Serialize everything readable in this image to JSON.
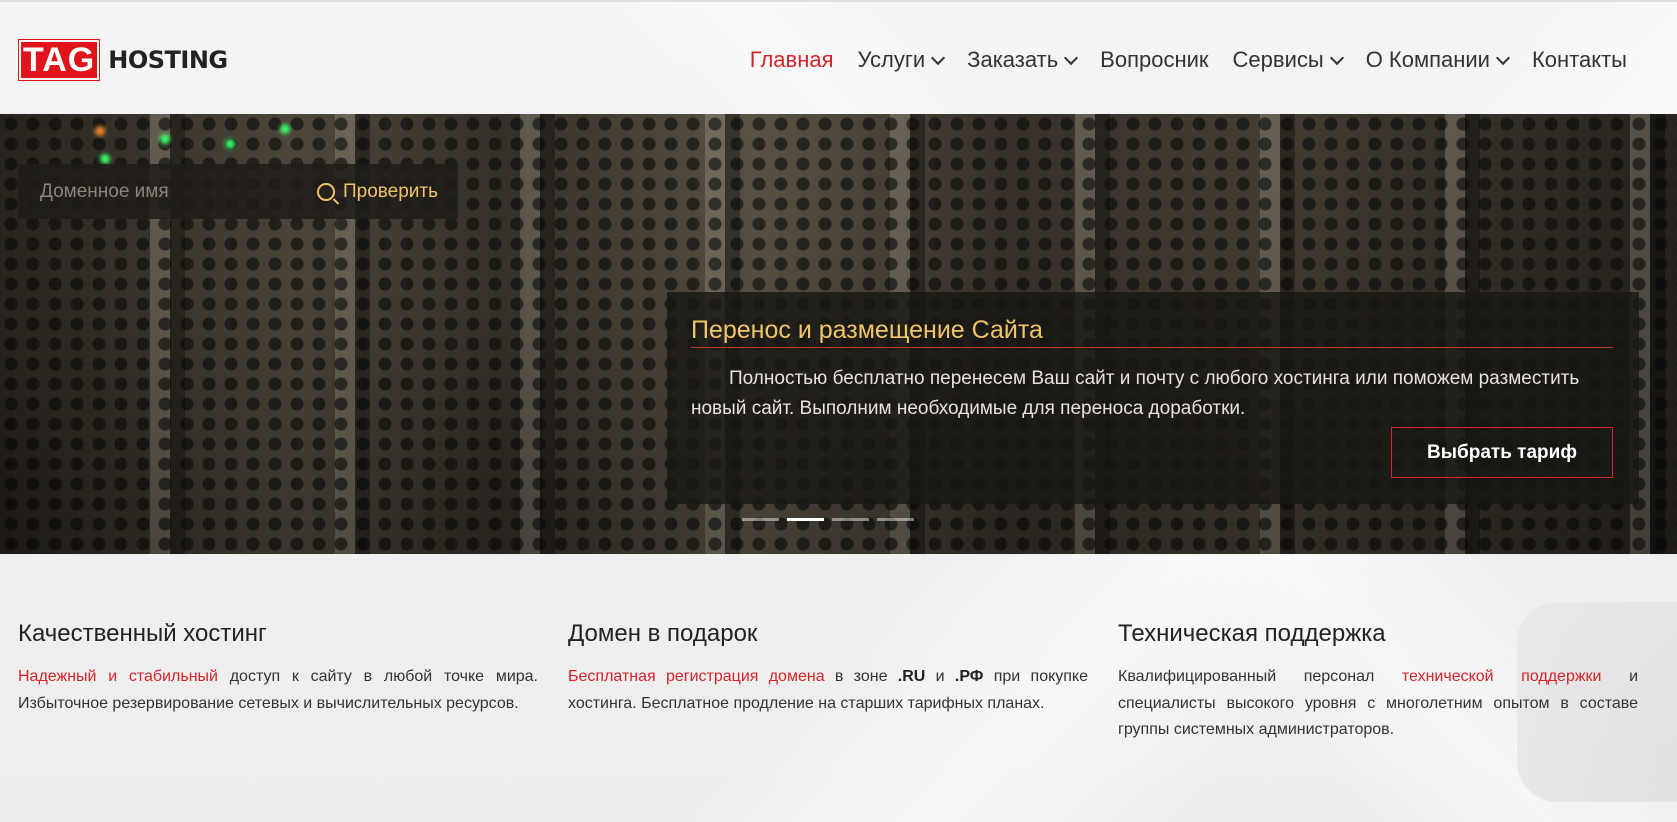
{
  "logo": {
    "tag": "TAG",
    "hosting": "HOSTING"
  },
  "nav": {
    "items": [
      {
        "label": "Главная",
        "active": true
      },
      {
        "label": "Услуги",
        "dropdown": true
      },
      {
        "label": "Заказать",
        "dropdown": true
      },
      {
        "label": "Вопросник"
      },
      {
        "label": "Сервисы",
        "dropdown": true
      },
      {
        "label": "О Компании",
        "dropdown": true
      },
      {
        "label": "Контакты"
      }
    ]
  },
  "domain_search": {
    "placeholder": "Доменное имя",
    "button_label": "Проверить",
    "icon": "search-icon"
  },
  "slide": {
    "title": "Перенос и размещение Сайта",
    "text": "Полностью бесплатно перенесем Ваш сайт и почту с любого хостинга или поможем разместить новый сайт. Выполним необходимые для переноса доработки.",
    "button_label": "Выбрать тариф",
    "dots_count": 4,
    "active_dot": 2
  },
  "features": [
    {
      "title": "Качественный хостинг",
      "highlight": "Надежный и стабильный",
      "text": " доступ к сайту в любой точке мира. Избыточное резервирование сетевых и вычислительных ресурсов."
    },
    {
      "title": "Домен в подарок",
      "highlight": "Бесплатная регистрация домена",
      "text_a": " в зоне ",
      "bold_a": ".RU",
      "text_b": " и ",
      "bold_b": ".РФ",
      "text_c": " при покупке хостинга. Бесплатное продление на старших тарифных планах."
    },
    {
      "title": "Техническая поддержка",
      "text_a": "Квалифицированный персонал ",
      "highlight": "технической поддержки",
      "text_b": " и специалисты высокого уровня с многолетним опытом в составе группы системных администраторов."
    }
  ],
  "colors": {
    "accent": "#d5232a",
    "gold": "#f0c46a"
  }
}
